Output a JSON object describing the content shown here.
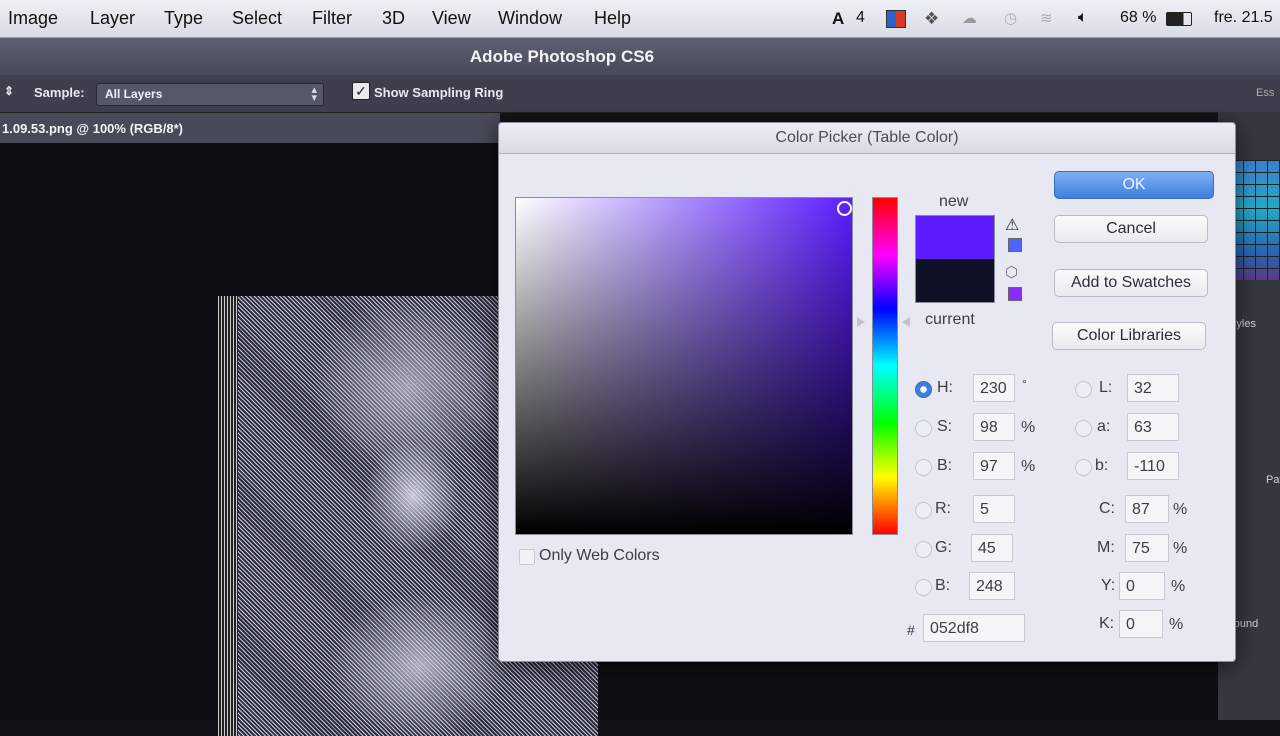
{
  "menubar": {
    "items": [
      "Image",
      "Layer",
      "Type",
      "Select",
      "Filter",
      "3D",
      "View",
      "Window",
      "Help"
    ],
    "status_number": "4",
    "battery": "68 %",
    "clock": "fre. 21.5"
  },
  "app": {
    "title": "Adobe Photoshop CS6"
  },
  "options_bar": {
    "sample_label": "Sample:",
    "sample_value": "All Layers",
    "show_sampling_ring_label": "Show Sampling Ring",
    "show_sampling_ring_checked": true,
    "right_label": "Ess"
  },
  "document": {
    "tab_label": "1.09.53.png @ 100% (RGB/8*)"
  },
  "panels": {
    "styles_tab": "Styles",
    "ground_label": "ground",
    "paths_tab": "Path"
  },
  "color_picker": {
    "title": "Color Picker (Table Color)",
    "new_label": "new",
    "current_label": "current",
    "new_color": "#5b1dff",
    "current_color": "#0f1226",
    "buttons": {
      "ok": "OK",
      "cancel": "Cancel",
      "add_to_swatches": "Add to Swatches",
      "color_libraries": "Color Libraries"
    },
    "only_web_colors": "Only Web Colors",
    "hsb": {
      "h_label": "H:",
      "h_value": "230",
      "h_unit": "°",
      "s_label": "S:",
      "s_value": "98",
      "s_unit": "%",
      "b_label": "B:",
      "b_value": "97",
      "b_unit": "%"
    },
    "rgb": {
      "r_label": "R:",
      "r_value": "5",
      "g_label": "G:",
      "g_value": "45",
      "b_label": "B:",
      "b_value": "248"
    },
    "lab": {
      "l_label": "L:",
      "l_value": "32",
      "a_label": "a:",
      "a_value": "63",
      "b_label": "b:",
      "b_value": "-110"
    },
    "cmyk": {
      "c_label": "C:",
      "c_value": "87",
      "m_label": "M:",
      "m_value": "75",
      "y_label": "Y:",
      "y_value": "0",
      "k_label": "K:",
      "k_value": "0",
      "unit": "%"
    },
    "hex_label": "#",
    "hex_value": "052df8"
  }
}
